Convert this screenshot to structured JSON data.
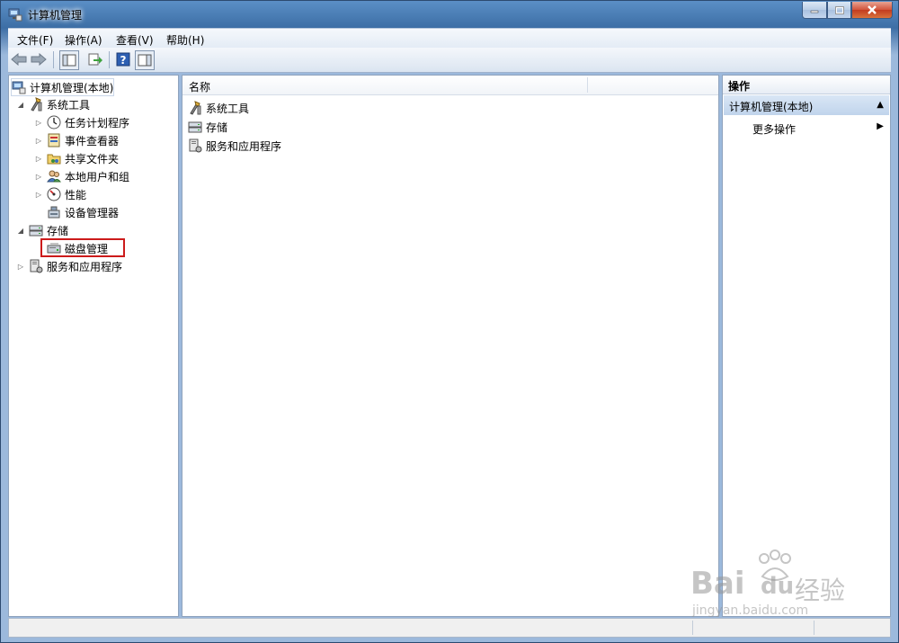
{
  "window": {
    "title": "计算机管理"
  },
  "menu": [
    "文件(F)",
    "操作(A)",
    "查看(V)",
    "帮助(H)"
  ],
  "tree": {
    "root": "计算机管理(本地)",
    "system_tools": "系统工具",
    "task_scheduler": "任务计划程序",
    "event_viewer": "事件查看器",
    "shared_folders": "共享文件夹",
    "local_users": "本地用户和组",
    "performance": "性能",
    "device_manager": "设备管理器",
    "storage": "存储",
    "disk_management": "磁盘管理",
    "services_apps": "服务和应用程序"
  },
  "list": {
    "header_name": "名称",
    "items": [
      "系统工具",
      "存储",
      "服务和应用程序"
    ]
  },
  "actions": {
    "header": "操作",
    "section": "计算机管理(本地)",
    "more": "更多操作"
  },
  "watermark": {
    "brand": "Bai",
    "brand2": "du",
    "cn": "经验",
    "url": "jingyan.baidu.com"
  }
}
